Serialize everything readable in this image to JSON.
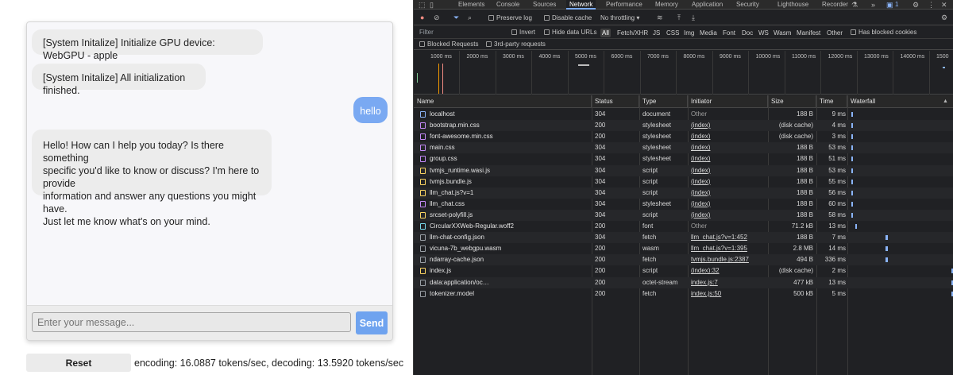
{
  "chat": {
    "messages": [
      {
        "role": "system",
        "text": "[System Initalize] Initialize GPU device: WebGPU - apple"
      },
      {
        "role": "system",
        "text": "[System Initalize] All initialization finished."
      },
      {
        "role": "user",
        "text": "hello"
      },
      {
        "role": "assistant",
        "text": "Hello! How can I help you today? Is there something\nspecific you'd like to know or discuss? I'm here to provide\ninformation and answer any questions you might have.\nJust let me know what's on your mind."
      }
    ],
    "input_placeholder": "Enter your message...",
    "send_label": "Send",
    "reset_label": "Reset",
    "stats": "encoding: 16.0887 tokens/sec, decoding: 13.5920 tokens/sec"
  },
  "devtools": {
    "tabs": [
      "Elements",
      "Console",
      "Sources",
      "Network",
      "Performance",
      "Memory",
      "Application",
      "Security",
      "Lighthouse",
      "Recorder"
    ],
    "active_tab": "Network",
    "issues_count": "1",
    "toolbar": {
      "preserve_log": "Preserve log",
      "disable_cache": "Disable cache",
      "throttling": "No throttling"
    },
    "filter": {
      "placeholder": "Filter",
      "invert": "Invert",
      "hide_data_urls": "Hide data URLs",
      "types": [
        "All",
        "Fetch/XHR",
        "JS",
        "CSS",
        "Img",
        "Media",
        "Font",
        "Doc",
        "WS",
        "Wasm",
        "Manifest",
        "Other"
      ],
      "active_type": "All",
      "has_blocked_cookies": "Has blocked cookies",
      "blocked_requests": "Blocked Requests",
      "third_party": "3rd-party requests"
    },
    "overview_ticks": [
      "1000 ms",
      "2000 ms",
      "3000 ms",
      "4000 ms",
      "5000 ms",
      "6000 ms",
      "7000 ms",
      "8000 ms",
      "9000 ms",
      "10000 ms",
      "11000 ms",
      "12000 ms",
      "13000 ms",
      "14000 ms",
      "1500"
    ],
    "columns": {
      "name": "Name",
      "status": "Status",
      "type": "Type",
      "initiator": "Initiator",
      "size": "Size",
      "time": "Time",
      "waterfall": "Waterfall"
    },
    "requests": [
      {
        "name": "localhost",
        "status": "304",
        "type": "document",
        "initiator": "Other",
        "size": "188 B",
        "time": "9 ms",
        "icon": "document-icon",
        "color": "#8ab4f8",
        "wf": 0.004
      },
      {
        "name": "bootstrap.min.css",
        "status": "200",
        "type": "stylesheet",
        "initiator": "(index)",
        "size": "(disk cache)",
        "time": "4 ms",
        "icon": "stylesheet-icon",
        "color": "#c58af9",
        "wf": 0.006
      },
      {
        "name": "font-awesome.min.css",
        "status": "200",
        "type": "stylesheet",
        "initiator": "(index)",
        "size": "(disk cache)",
        "time": "3 ms",
        "icon": "stylesheet-icon",
        "color": "#c58af9",
        "wf": 0.006
      },
      {
        "name": "main.css",
        "status": "304",
        "type": "stylesheet",
        "initiator": "(index)",
        "size": "188 B",
        "time": "53 ms",
        "icon": "stylesheet-icon",
        "color": "#c58af9",
        "wf": 0.006
      },
      {
        "name": "group.css",
        "status": "304",
        "type": "stylesheet",
        "initiator": "(index)",
        "size": "188 B",
        "time": "51 ms",
        "icon": "stylesheet-icon",
        "color": "#c58af9",
        "wf": 0.006
      },
      {
        "name": "tvmjs_runtime.wasi.js",
        "status": "304",
        "type": "script",
        "initiator": "(index)",
        "size": "188 B",
        "time": "53 ms",
        "icon": "script-icon",
        "color": "#fdd663",
        "wf": 0.006
      },
      {
        "name": "tvmjs.bundle.js",
        "status": "304",
        "type": "script",
        "initiator": "(index)",
        "size": "188 B",
        "time": "55 ms",
        "icon": "script-icon",
        "color": "#fdd663",
        "wf": 0.006
      },
      {
        "name": "llm_chat.js?v=1",
        "status": "304",
        "type": "script",
        "initiator": "(index)",
        "size": "188 B",
        "time": "56 ms",
        "icon": "script-icon",
        "color": "#fdd663",
        "wf": 0.006
      },
      {
        "name": "llm_chat.css",
        "status": "304",
        "type": "stylesheet",
        "initiator": "(index)",
        "size": "188 B",
        "time": "60 ms",
        "icon": "stylesheet-icon",
        "color": "#c58af9",
        "wf": 0.006
      },
      {
        "name": "srcset-polyfill.js",
        "status": "304",
        "type": "script",
        "initiator": "(index)",
        "size": "188 B",
        "time": "58 ms",
        "icon": "script-icon",
        "color": "#fdd663",
        "wf": 0.006
      },
      {
        "name": "CircularXXWeb-Regular.woff2",
        "status": "200",
        "type": "font",
        "initiator": "Other",
        "size": "71.2 kB",
        "time": "13 ms",
        "icon": "font-icon",
        "color": "#78d9ec",
        "wf": 0.05
      },
      {
        "name": "llm-chat-config.json",
        "status": "304",
        "type": "fetch",
        "initiator": "llm_chat.js?v=1:452",
        "size": "188 B",
        "time": "7 ms",
        "icon": "fetch-icon",
        "color": "#9aa0a6",
        "wf": 0.34
      },
      {
        "name": "vicuna-7b_webgpu.wasm",
        "status": "200",
        "type": "wasm",
        "initiator": "llm_chat.js?v=1:395",
        "size": "2.8 MB",
        "time": "14 ms",
        "icon": "wasm-icon",
        "color": "#9aa0a6",
        "wf": 0.34
      },
      {
        "name": "ndarray-cache.json",
        "status": "200",
        "type": "fetch",
        "initiator": "tvmjs.bundle.js:2387",
        "size": "494 B",
        "time": "336 ms",
        "icon": "fetch-icon",
        "color": "#9aa0a6",
        "wf": 0.34
      },
      {
        "name": "index.js",
        "status": "200",
        "type": "script",
        "initiator": "(index):32",
        "size": "(disk cache)",
        "time": "2 ms",
        "icon": "script-icon",
        "color": "#fdd663",
        "wf": 0.99
      },
      {
        "name": "data:application/oc…",
        "status": "200",
        "type": "octet-stream",
        "initiator": "index.js:7",
        "size": "477 kB",
        "time": "13 ms",
        "icon": "file-icon",
        "color": "#9aa0a6",
        "wf": 0.99
      },
      {
        "name": "tokenizer.model",
        "status": "200",
        "type": "fetch",
        "initiator": "index.js:50",
        "size": "500 kB",
        "time": "5 ms",
        "icon": "fetch-icon",
        "color": "#9aa0a6",
        "wf": 0.99
      }
    ]
  }
}
